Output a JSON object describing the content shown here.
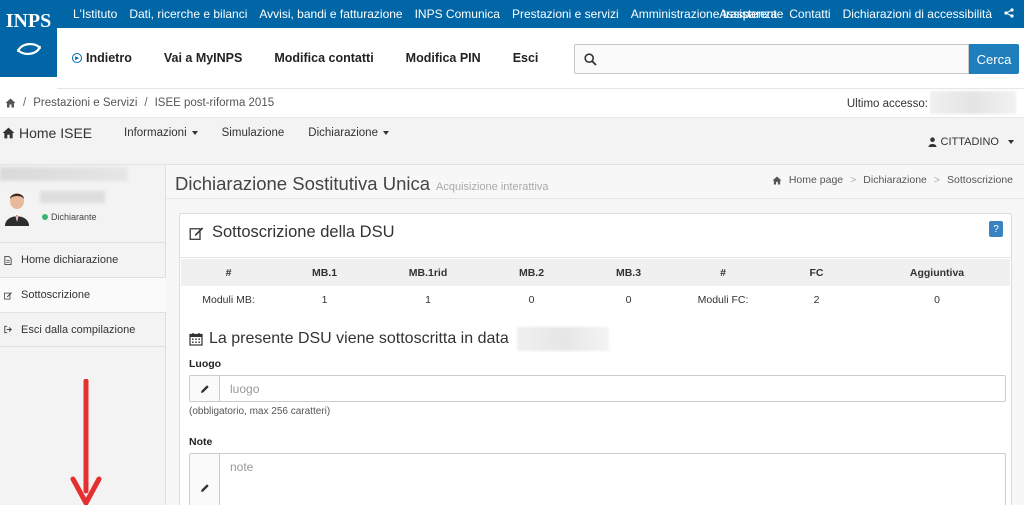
{
  "logo": {
    "text": "INPS"
  },
  "topbar": {
    "links": [
      "L'Istituto",
      "Dati, ricerche e bilanci",
      "Avvisi, bandi e fatturazione",
      "INPS Comunica",
      "Prestazioni e servizi",
      "Amministrazione trasparente"
    ],
    "right_links": [
      "Assistenza",
      "Contatti",
      "Dichiarazioni di accessibilità"
    ],
    "color": "#0066a6"
  },
  "nav2": {
    "back": "Indietro",
    "myinps": "Vai a MyINPS",
    "contacts": "Modifica contatti",
    "pin": "Modifica PIN",
    "exit": "Esci",
    "search_placeholder": "",
    "search_button": "Cerca"
  },
  "breadcrumb": {
    "items": [
      "Prestazioni e Servizi",
      "ISEE post-riforma 2015"
    ],
    "last_access_label": "Ultimo accesso:"
  },
  "isee_bar": {
    "home": "Home ISEE",
    "menu": [
      "Informazioni",
      "Simulazione",
      "Dichiarazione"
    ],
    "user": "CITTADINO"
  },
  "sidebar": {
    "role": "Dichiarante",
    "items": [
      {
        "label": "Home dichiarazione",
        "icon": "document-icon"
      },
      {
        "label": "Sottoscrizione",
        "icon": "edit-icon"
      },
      {
        "label": "Esci dalla compilazione",
        "icon": "sign-out-icon"
      }
    ]
  },
  "page": {
    "title": "Dichiarazione Sostitutiva Unica",
    "subtitle": "Acquisizione interattiva",
    "crumbs": [
      "Home page",
      "Dichiarazione",
      "Sottoscrizione"
    ]
  },
  "card": {
    "title": "Sottoscrizione della DSU",
    "help": "?",
    "table": {
      "headers": [
        "#",
        "MB.1",
        "MB.1rid",
        "MB.2",
        "MB.3",
        "#",
        "FC",
        "Aggiuntiva"
      ],
      "row": [
        "Moduli MB:",
        "1",
        "1",
        "0",
        "0",
        "Moduli FC:",
        "2",
        "0"
      ]
    },
    "date_text": "La presente DSU viene sottoscritta in data",
    "luogo_label": "Luogo",
    "luogo_placeholder": "luogo",
    "luogo_hint": "(obbligatorio, max 256 caratteri)",
    "note_label": "Note",
    "note_placeholder": "note"
  },
  "annotation": {
    "arrow_color": "#e53030"
  }
}
